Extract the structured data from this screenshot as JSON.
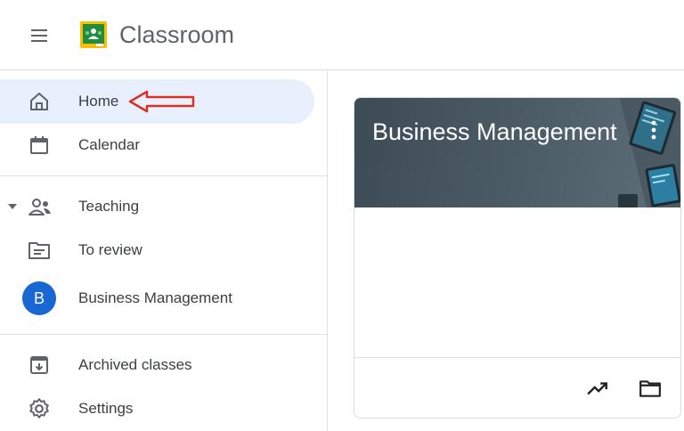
{
  "app": {
    "title": "Classroom"
  },
  "sidebar": {
    "items": [
      {
        "label": "Home",
        "icon": "home-icon",
        "active": true
      },
      {
        "label": "Calendar",
        "icon": "calendar-icon"
      },
      {
        "label": "Teaching",
        "icon": "people-icon"
      },
      {
        "label": "To review",
        "icon": "review-folder-icon"
      },
      {
        "label": "Business Management",
        "icon": "class-avatar",
        "avatar_letter": "B"
      },
      {
        "label": "Archived classes",
        "icon": "archive-icon"
      },
      {
        "label": "Settings",
        "icon": "gear-icon"
      }
    ]
  },
  "card": {
    "title": "Business Management",
    "footer_icons": [
      "trending-up-icon",
      "folder-icon"
    ]
  },
  "colors": {
    "active_nav_bg": "#e8f0fe",
    "avatar": "#1967d2",
    "annotation_arrow": "#d93025",
    "card_header": "#4d5d68"
  }
}
